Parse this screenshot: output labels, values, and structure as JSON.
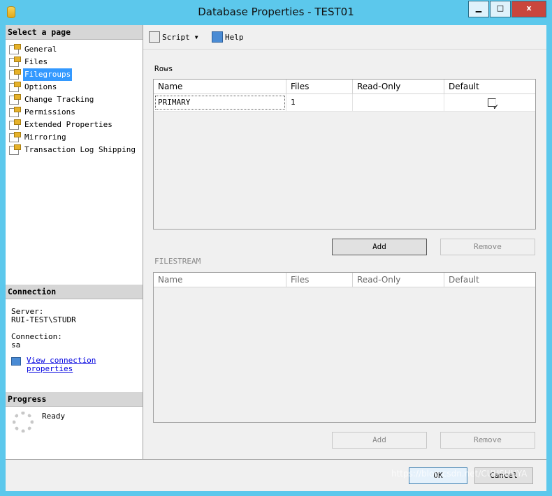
{
  "window": {
    "title": "Database Properties - TEST01",
    "minimize_label": "▁",
    "maximize_label": "□",
    "close_label": "x"
  },
  "sidebar": {
    "header": "Select a page",
    "items": [
      {
        "label": "General",
        "selected": false
      },
      {
        "label": "Files",
        "selected": false
      },
      {
        "label": "Filegroups",
        "selected": true
      },
      {
        "label": "Options",
        "selected": false
      },
      {
        "label": "Change Tracking",
        "selected": false
      },
      {
        "label": "Permissions",
        "selected": false
      },
      {
        "label": "Extended Properties",
        "selected": false
      },
      {
        "label": "Mirroring",
        "selected": false
      },
      {
        "label": "Transaction Log Shipping",
        "selected": false
      }
    ]
  },
  "connection": {
    "header": "Connection",
    "server_label": "Server:",
    "server_value": "RUI-TEST\\STUDR",
    "connection_label": "Connection:",
    "connection_value": "sa",
    "link_line1": "View connection",
    "link_line2": "properties"
  },
  "progress": {
    "header": "Progress",
    "status": "Ready"
  },
  "toolbar": {
    "script_label": "Script",
    "help_label": "Help"
  },
  "rows_section": {
    "label": "Rows",
    "columns": [
      "Name",
      "Files",
      "Read-Only",
      "Default"
    ],
    "rows": [
      {
        "name": "PRIMARY",
        "files": "1",
        "read_only": false,
        "default": true
      }
    ],
    "add_label": "Add",
    "remove_label": "Remove"
  },
  "filestream_section": {
    "label": "FILESTREAM",
    "columns": [
      "Name",
      "Files",
      "Read-Only",
      "Default"
    ],
    "add_label": "Add",
    "remove_label": "Remove"
  },
  "footer": {
    "ok_label": "OK",
    "cancel_label": "Cancel",
    "watermark": "https://blog.csdn.net/CUUSHUYA"
  }
}
